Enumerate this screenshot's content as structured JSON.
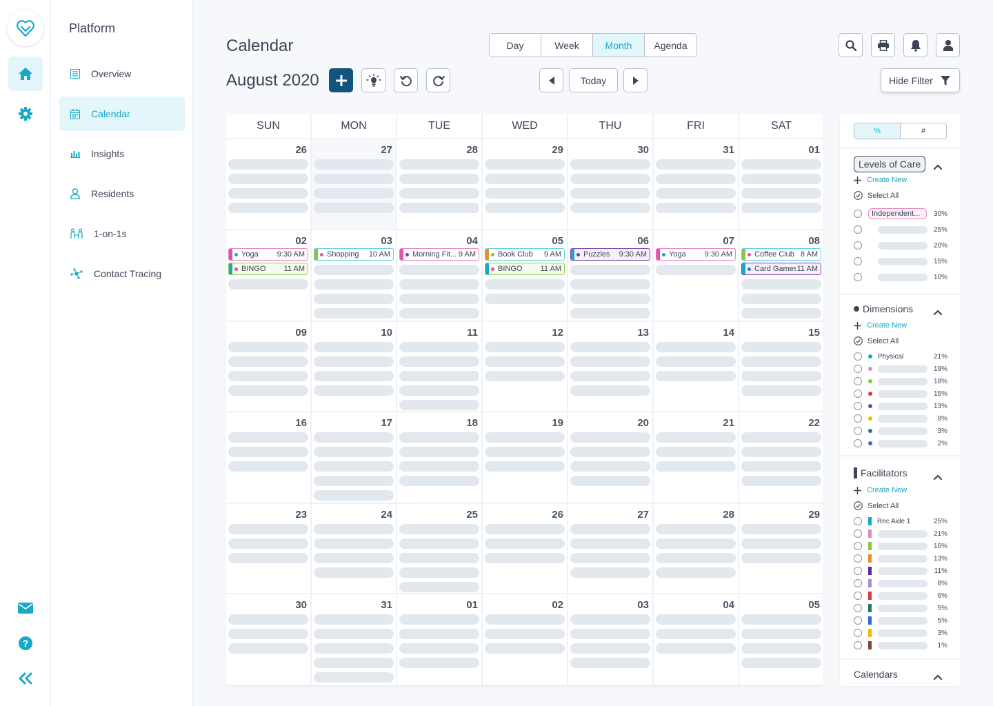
{
  "nav": {
    "title": "Platform",
    "items": [
      {
        "label": "Overview",
        "icon": "list-icon"
      },
      {
        "label": "Calendar",
        "icon": "calendar-icon"
      },
      {
        "label": "Insights",
        "icon": "bar-chart-icon"
      },
      {
        "label": "Residents",
        "icon": "user-icon"
      },
      {
        "label": "1-on-1s",
        "icon": "people-link-icon"
      },
      {
        "label": "Contact Tracing",
        "icon": "network-icon"
      }
    ]
  },
  "header": {
    "title": "Calendar",
    "month": "August 2020",
    "views": [
      "Day",
      "Week",
      "Month",
      "Agenda"
    ],
    "active_view": "Month",
    "today": "Today",
    "hide_filter": "Hide Filter"
  },
  "calendar": {
    "weekdays": [
      "SUN",
      "MON",
      "TUE",
      "WED",
      "THU",
      "FRI",
      "SAT"
    ],
    "weeks": [
      {
        "days": [
          {
            "n": "26",
            "ph": 4
          },
          {
            "n": "27",
            "ph": 4,
            "other": true
          },
          {
            "n": "28",
            "ph": 4
          },
          {
            "n": "29",
            "ph": 4
          },
          {
            "n": "30",
            "ph": 4
          },
          {
            "n": "31",
            "ph": 4
          },
          {
            "n": "01",
            "ph": 4
          }
        ]
      },
      {
        "days": [
          {
            "n": "02",
            "ph": 1,
            "events": [
              {
                "title": "Yoga",
                "time": "9:30 AM",
                "stripe": "#e84fa7",
                "border": "#e884c2",
                "dot": "#17a9c6"
              },
              {
                "title": "BINGO",
                "time": "11 AM",
                "stripe": "#17a9c6",
                "border": "#8cd34b",
                "dot": "#e84fa7",
                "bg": "#f5fbee"
              }
            ]
          },
          {
            "n": "03",
            "ph": 4,
            "events": [
              {
                "title": "Shopping",
                "time": "10 AM",
                "stripe": "#8cc63f",
                "border": "#5fcfe3",
                "dot": "#e84fa7"
              }
            ]
          },
          {
            "n": "04",
            "ph": 4,
            "events": [
              {
                "title": "Morning Fit...",
                "time": "9 AM",
                "stripe": "#e84fa7",
                "border": "#e884c2",
                "dot": "#7b3fb2"
              }
            ]
          },
          {
            "n": "05",
            "ph": 2,
            "events": [
              {
                "title": "Book Club",
                "time": "9 AM",
                "stripe": "#f28c1e",
                "border": "#5fcfe3",
                "dot": "#8cc63f"
              },
              {
                "title": "BINGO",
                "time": "11 AM",
                "stripe": "#17a9c6",
                "border": "#8cd34b",
                "dot": "#e84fa7",
                "bg": "#f5fbee"
              }
            ]
          },
          {
            "n": "06",
            "ph": 4,
            "events": [
              {
                "title": "Puzzles",
                "time": "9:30 AM",
                "stripe": "#17a9c6",
                "border": "#7b3fb2",
                "dot": "#7b3fb2",
                "bg": "#f6f0fb"
              }
            ]
          },
          {
            "n": "07",
            "ph": 1,
            "events": [
              {
                "title": "Yoga",
                "time": "9:30 AM",
                "stripe": "#e84fa7",
                "border": "#e884c2",
                "dot": "#17a9c6"
              }
            ]
          },
          {
            "n": "08",
            "ph": 3,
            "events": [
              {
                "title": "Coffee Club",
                "time": "8 AM",
                "stripe": "#8cc63f",
                "border": "#5fcfe3",
                "dot": "#e84fa7"
              },
              {
                "title": "Card Games",
                "time": "11 AM",
                "stripe": "#17a9c6",
                "border": "#7b3fb2",
                "dot": "#2d6fd8",
                "bg": "#f6f0fb"
              }
            ]
          }
        ]
      },
      {
        "days": [
          {
            "n": "09",
            "ph": 4
          },
          {
            "n": "10",
            "ph": 4
          },
          {
            "n": "11",
            "ph": 5
          },
          {
            "n": "12",
            "ph": 3
          },
          {
            "n": "13",
            "ph": 4
          },
          {
            "n": "14",
            "ph": 3
          },
          {
            "n": "15",
            "ph": 4
          }
        ]
      },
      {
        "days": [
          {
            "n": "16",
            "ph": 3
          },
          {
            "n": "17",
            "ph": 5
          },
          {
            "n": "18",
            "ph": 4
          },
          {
            "n": "19",
            "ph": 3
          },
          {
            "n": "20",
            "ph": 4
          },
          {
            "n": "21",
            "ph": 3
          },
          {
            "n": "22",
            "ph": 4
          }
        ]
      },
      {
        "days": [
          {
            "n": "23",
            "ph": 3
          },
          {
            "n": "24",
            "ph": 4
          },
          {
            "n": "25",
            "ph": 5
          },
          {
            "n": "26",
            "ph": 3
          },
          {
            "n": "27",
            "ph": 4
          },
          {
            "n": "28",
            "ph": 4
          },
          {
            "n": "29",
            "ph": 3
          }
        ]
      },
      {
        "days": [
          {
            "n": "30",
            "ph": 3
          },
          {
            "n": "31",
            "ph": 5
          },
          {
            "n": "01",
            "ph": 4
          },
          {
            "n": "02",
            "ph": 3
          },
          {
            "n": "03",
            "ph": 4
          },
          {
            "n": "04",
            "ph": 3
          },
          {
            "n": "05",
            "ph": 4
          }
        ]
      }
    ]
  },
  "filter": {
    "toggle": [
      "%",
      "#"
    ],
    "create_new": "Create New",
    "select_all": "Select All",
    "levels": {
      "title": "Levels of Care",
      "rows": [
        {
          "label": "Independent...",
          "pct": "30%"
        },
        {
          "label": "",
          "pct": "25%"
        },
        {
          "label": "",
          "pct": "20%"
        },
        {
          "label": "",
          "pct": "15%"
        },
        {
          "label": "",
          "pct": "10%"
        }
      ]
    },
    "dimensions": {
      "title": "Dimensions",
      "rows": [
        {
          "label": "Physical",
          "pct": "21%",
          "color": "#17a9c6"
        },
        {
          "label": "",
          "pct": "19%",
          "color": "#e884c2"
        },
        {
          "label": "",
          "pct": "18%",
          "color": "#8cc63f"
        },
        {
          "label": "",
          "pct": "15%",
          "color": "#d93b3b"
        },
        {
          "label": "",
          "pct": "13%",
          "color": "#7b3fb2"
        },
        {
          "label": "",
          "pct": "9%",
          "color": "#f5b800"
        },
        {
          "label": "",
          "pct": "3%",
          "color": "#1f7a6b"
        },
        {
          "label": "",
          "pct": "2%",
          "color": "#2d6fd8"
        }
      ]
    },
    "facilitators": {
      "title": "Facilitators",
      "rows": [
        {
          "label": "Rec Aide 1",
          "pct": "25%",
          "color": "#17a9c6"
        },
        {
          "label": "",
          "pct": "21%",
          "color": "#e884c2"
        },
        {
          "label": "",
          "pct": "16%",
          "color": "#8cc63f"
        },
        {
          "label": "",
          "pct": "13%",
          "color": "#f28c1e"
        },
        {
          "label": "",
          "pct": "11%",
          "color": "#5b2a9e"
        },
        {
          "label": "",
          "pct": "8%",
          "color": "#b08ad8"
        },
        {
          "label": "",
          "pct": "6%",
          "color": "#d93b3b"
        },
        {
          "label": "",
          "pct": "5%",
          "color": "#1f7a6b"
        },
        {
          "label": "",
          "pct": "5%",
          "color": "#2d6fd8"
        },
        {
          "label": "",
          "pct": "3%",
          "color": "#f5b800"
        },
        {
          "label": "",
          "pct": "1%",
          "color": "#7a4a3a"
        }
      ]
    },
    "calendars": {
      "title": "Calendars"
    }
  },
  "colors": {
    "accent": "#17a9c6",
    "primary": "#13547e"
  }
}
